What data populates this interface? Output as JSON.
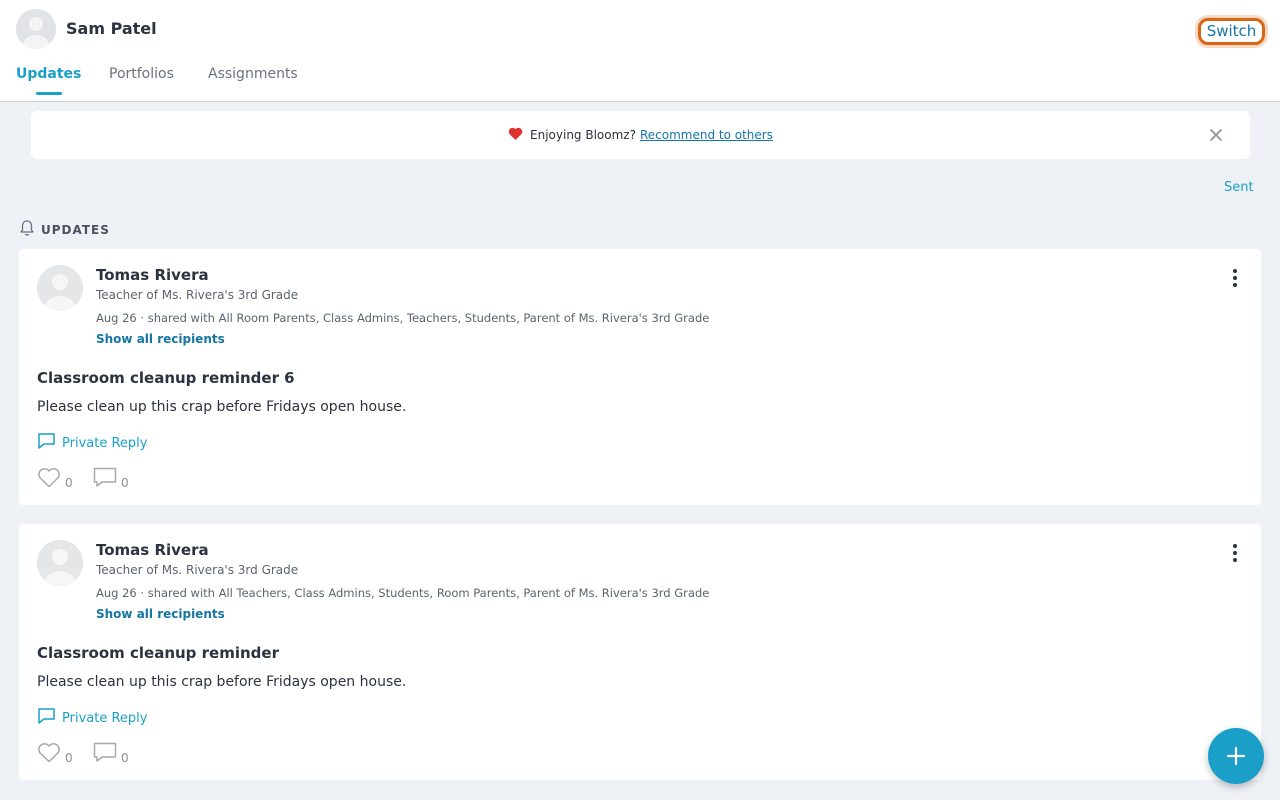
{
  "header": {
    "user_name": "Sam Patel",
    "switch_label": "Switch",
    "tabs": [
      {
        "label": "Updates",
        "active": true
      },
      {
        "label": "Portfolios",
        "active": false
      },
      {
        "label": "Assignments",
        "active": false
      }
    ]
  },
  "banner": {
    "icon": "heart-icon",
    "text": "Enjoying Bloomz?",
    "link": "Recommend to others"
  },
  "sent_label": "Sent",
  "section_title": "UPDATES",
  "posts": [
    {
      "author": "Tomas Rivera",
      "role": "Teacher of Ms. Rivera's 3rd Grade",
      "meta": "Aug 26 · shared with All Room Parents, Class Admins, Teachers, Students, Parent of Ms. Rivera's 3rd Grade",
      "show_all": "Show all recipients",
      "title": "Classroom cleanup reminder 6",
      "body": "Please clean up this crap before Fridays open house.",
      "reply_label": "Private Reply",
      "likes": "0",
      "comments": "0"
    },
    {
      "author": "Tomas Rivera",
      "role": "Teacher of Ms. Rivera's 3rd Grade",
      "meta": "Aug 26 · shared with All Teachers, Class Admins, Students, Room Parents, Parent of Ms. Rivera's 3rd Grade",
      "show_all": "Show all recipients",
      "title": "Classroom cleanup reminder",
      "body": "Please clean up this crap before Fridays open house.",
      "reply_label": "Private Reply",
      "likes": "0",
      "comments": "0"
    }
  ],
  "colors": {
    "accent": "#1aa0c8",
    "link": "#1576a3",
    "switch_focus": "#d86614",
    "background": "#eef1f6"
  }
}
